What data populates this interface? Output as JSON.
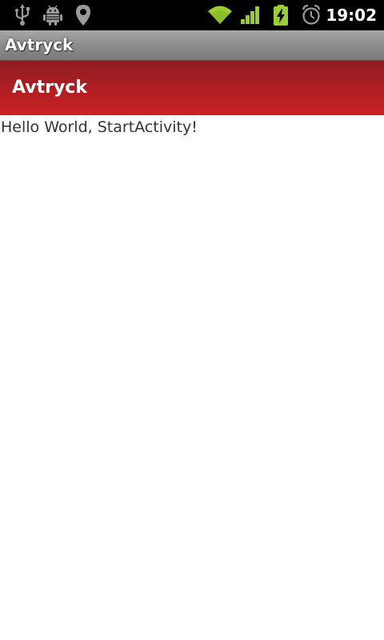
{
  "status_bar": {
    "time": "19:02",
    "icons": [
      "usb-icon",
      "android-debug-icon",
      "location-pin-icon",
      "wifi-icon",
      "signal-icon",
      "battery-charging-icon",
      "alarm-icon"
    ],
    "accent_color": "#9acd32",
    "battery_level": 0.9
  },
  "title_bar": {
    "title": "Avtryck"
  },
  "header": {
    "title": "Avtryck",
    "color": "#c62126"
  },
  "content": {
    "text": "Hello World, StartActivity!"
  }
}
